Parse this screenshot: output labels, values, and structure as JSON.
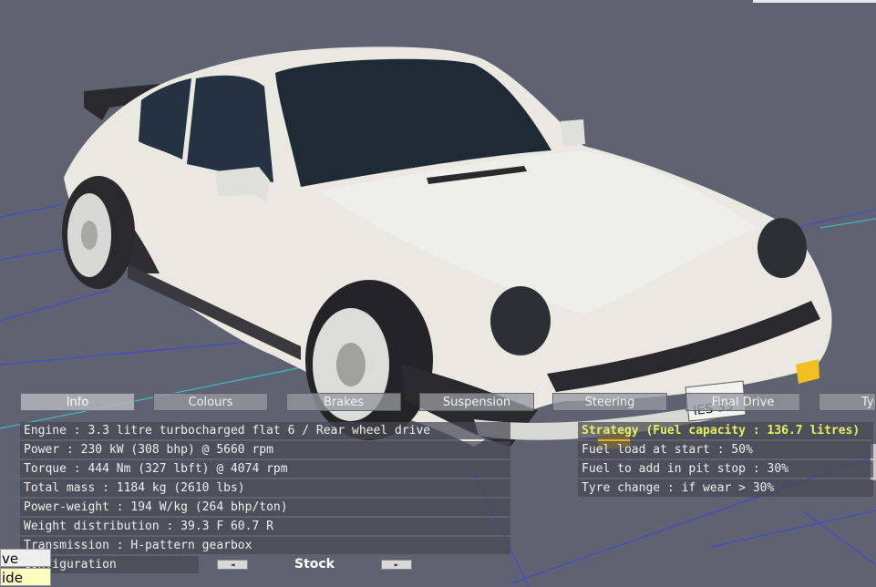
{
  "tabs": [
    "Info",
    "Colours",
    "Brakes",
    "Suspension",
    "Steering",
    "Final Drive",
    "Tyres"
  ],
  "active_tab": "Info",
  "info": {
    "engine": "Engine : 3.3 litre turbocharged flat 6 / Rear wheel drive",
    "power": "Power : 230 kW (308 bhp) @ 5660 rpm",
    "torque": "Torque : 444 Nm (327 lbft) @ 4074 rpm",
    "mass": "Total mass : 1184 kg (2610 lbs)",
    "power_weight": "Power-weight : 194 W/kg (264 bhp/ton)",
    "weight_distribution": "Weight distribution : 39.3 F  60.7 R",
    "transmission": "Transmission : H-pattern gearbox"
  },
  "strategy": {
    "title": "Strategy (Fuel capacity : 136.7 litres)",
    "fuel_load": "Fuel load at start : 50%",
    "fuel_add": "Fuel to add in pit stop : 30%",
    "tyre_change": "Tyre change : if wear > 30%"
  },
  "configuration": {
    "label": "Configuration",
    "value": "Stock",
    "prev_icon": "◄",
    "next_icon": "►"
  },
  "side_menu": {
    "item1": "ve",
    "item2": "ide"
  },
  "plate_text": "IES 33",
  "colors": {
    "car_body": "#e9e9e2",
    "highlight_text": "#e6f05a",
    "background": "#5f6270",
    "selected_menu": "#fffcc0"
  }
}
